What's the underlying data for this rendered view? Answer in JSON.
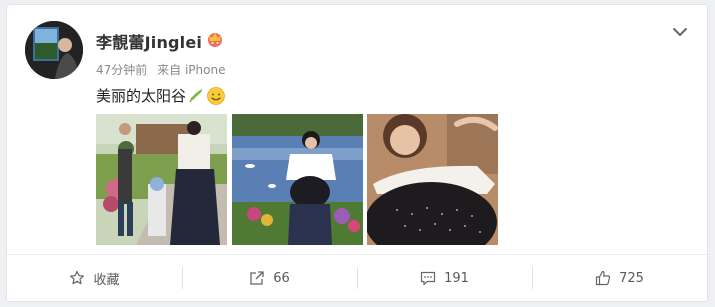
{
  "post": {
    "user_name": "李靚蕾Jinglei",
    "time": "47分钟前",
    "source_prefix": "来自",
    "source": "iPhone",
    "text": "美丽的太阳谷"
  },
  "actions": {
    "favorite_label": "收藏",
    "repost_count": "66",
    "comment_count": "191",
    "like_count": "725"
  },
  "colors": {
    "text": "#333333",
    "meta": "#8a8a8a",
    "background": "#eef0f3"
  },
  "icons": [
    "crown-icon",
    "chevron-down-icon",
    "leaf-emoji-icon",
    "smile-emoji-icon",
    "star-icon",
    "repost-icon",
    "comment-icon",
    "like-icon"
  ]
}
